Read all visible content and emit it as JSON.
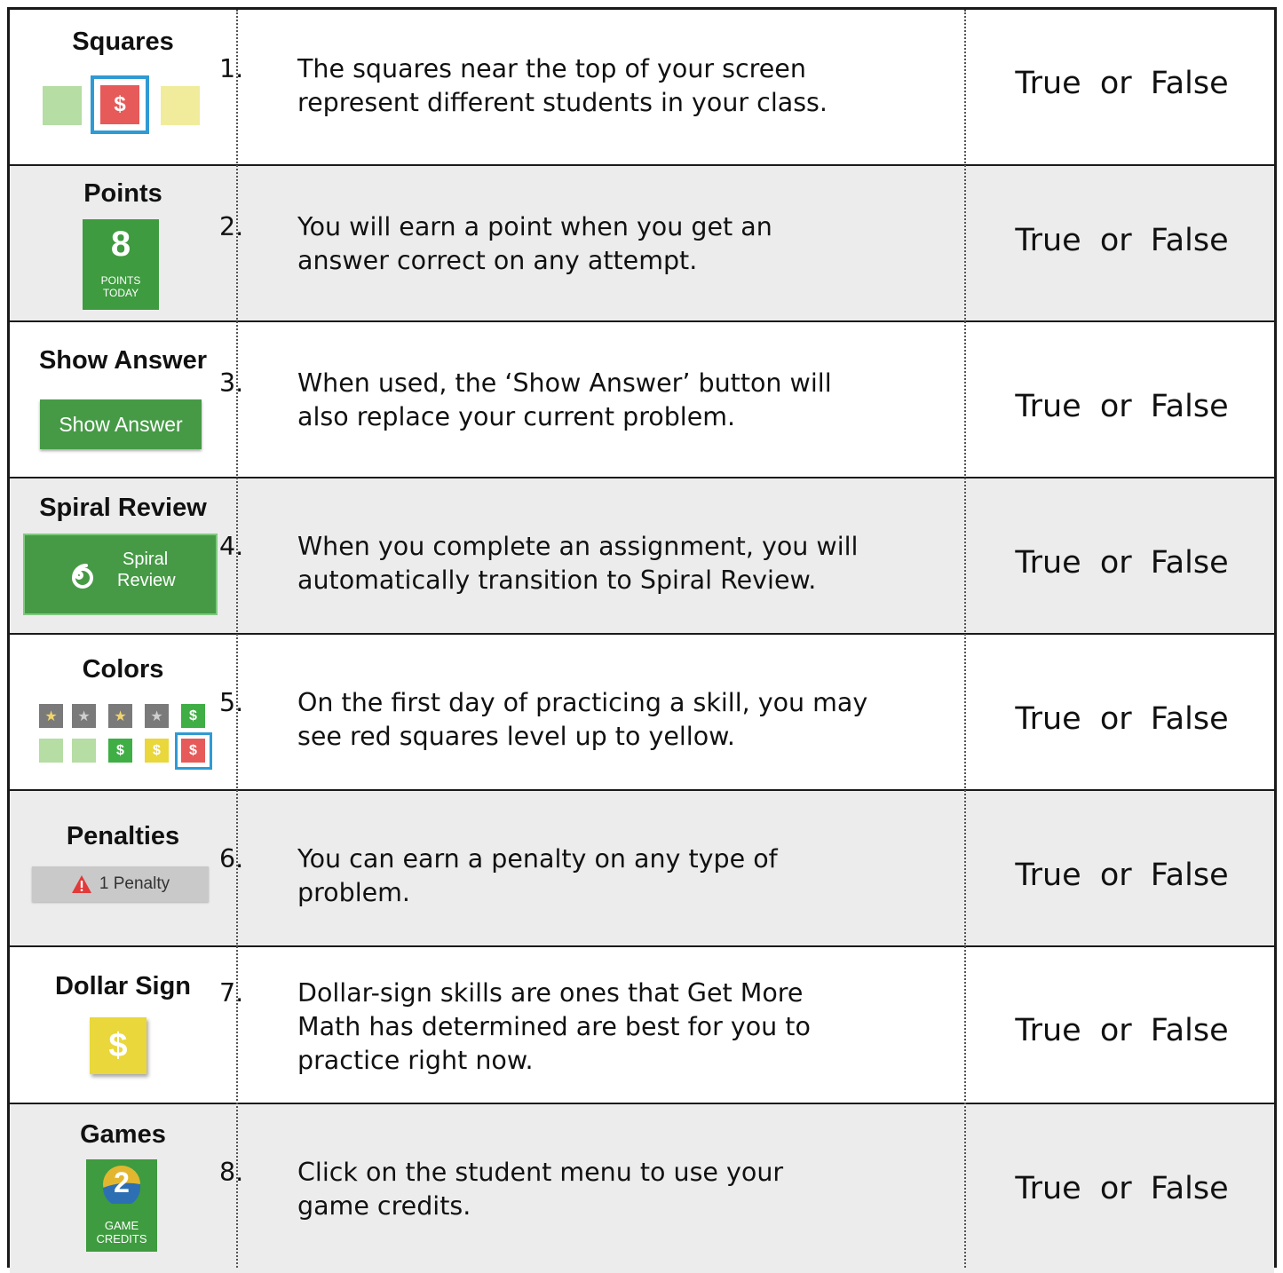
{
  "colors": {
    "green_square": "#b5dda4",
    "red_square": "#e65a5a",
    "yellow_square": "#f1ec9c",
    "highlight": "#2f9ad3",
    "badge_green": "#3e9b3f",
    "button_green": "#469a46",
    "gray_star": "#7a7a7a",
    "dollar_green": "#3fae45",
    "dollar_yellow": "#e9d73c",
    "penalty_gray": "#c9c9c9",
    "row_alt": "#ececec"
  },
  "answer_text": "True  or  False",
  "rows": [
    {
      "title": "Squares",
      "question_number": "1.",
      "question_lines": [
        "The squares near the top of your screen",
        "represent different students in your class."
      ],
      "icon": {
        "dollar": "$"
      }
    },
    {
      "title": "Points",
      "question_number": "2.",
      "question_lines": [
        "You will earn a point when you get an",
        "answer correct on any attempt."
      ],
      "icon": {
        "value": "8",
        "caption_1": "POINTS",
        "caption_2": "TODAY"
      }
    },
    {
      "title": "Show Answer",
      "question_number": "3.",
      "question_lines": [
        "When used, the ‘Show Answer’ button will",
        "also replace your current problem."
      ],
      "icon": {
        "label": "Show Answer"
      }
    },
    {
      "title": "Spiral Review",
      "question_number": "4.",
      "question_lines": [
        "When you complete an assignment, you will",
        "automatically transition to Spiral Review."
      ],
      "icon": {
        "label_1": "Spiral",
        "label_2": "Review",
        "icon_name": "spiral-icon"
      }
    },
    {
      "title": "Colors",
      "question_number": "5.",
      "question_lines": [
        "On the first day of practicing a skill, you may",
        "see red squares level up to yellow."
      ],
      "icon": {
        "star": "★",
        "dollar": "$"
      }
    },
    {
      "title": "Penalties",
      "question_number": "6.",
      "question_lines": [
        "You can earn a penalty on any type of",
        "problem."
      ],
      "icon": {
        "label": "1 Penalty",
        "icon_name": "warning-icon"
      }
    },
    {
      "title": "Dollar Sign",
      "question_number": "7.",
      "question_lines": [
        "Dollar-sign skills are ones that Get More",
        "Math has determined are best for you to",
        "practice right now."
      ],
      "icon": {
        "dollar": "$"
      }
    },
    {
      "title": "Games",
      "question_number": "8.",
      "question_lines": [
        "Click on the student menu to use your",
        "game credits."
      ],
      "icon": {
        "value": "2",
        "caption_1": "GAME",
        "caption_2": "CREDITS"
      }
    }
  ]
}
